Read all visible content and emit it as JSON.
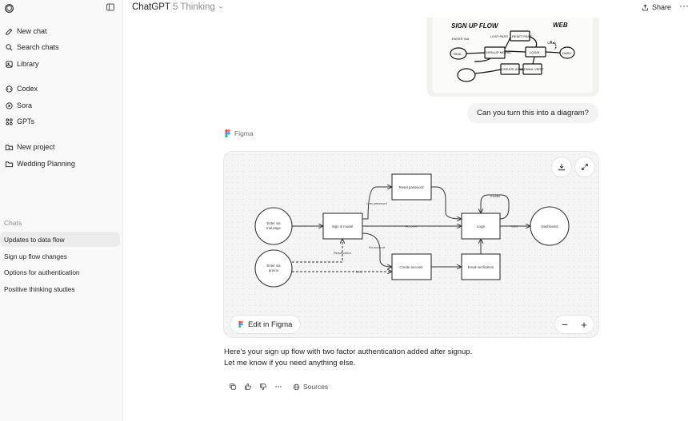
{
  "header": {
    "model_name": "ChatGPT",
    "model_version": "5 Thinking",
    "share_label": "Share",
    "more_label": "···"
  },
  "sidebar": {
    "nav": [
      {
        "label": "New chat",
        "icon": "new-chat-icon"
      },
      {
        "label": "Search chats",
        "icon": "search-icon"
      },
      {
        "label": "Library",
        "icon": "library-icon"
      },
      {
        "label": "Codex",
        "icon": "codex-icon"
      },
      {
        "label": "Sora",
        "icon": "sora-icon"
      },
      {
        "label": "GPTs",
        "icon": "gpts-icon"
      },
      {
        "label": "New project",
        "icon": "new-project-icon"
      },
      {
        "label": "Wedding Planning",
        "icon": "folder-icon"
      }
    ],
    "chats_label": "Chats",
    "chats": [
      {
        "label": "Updates to data flow",
        "active": true
      },
      {
        "label": "Sign up flow changes",
        "active": false
      },
      {
        "label": "Options for authentication",
        "active": false
      },
      {
        "label": "Positive thinking studies",
        "active": false
      }
    ]
  },
  "conversation": {
    "sketch": {
      "title": "SIGN UP FLOW",
      "corner": "WEB",
      "nodes": [
        "TRIAL",
        "SIGN-UP MODAL",
        "RESET PASS",
        "LOGIN",
        "DASH",
        "CREATE ACCT",
        "EMAIL VERIF",
        "ENTER VIA",
        "LOST PASS",
        "VALID"
      ]
    },
    "user_message": "Can you turn this into a diagram?",
    "tool_label": "Figma",
    "diagram": {
      "nodes": {
        "trial": "Enter via trial page",
        "promo": "Enter via promo",
        "modal": "Sign in modal",
        "reset": "Reset password",
        "login": "Login",
        "create": "Create account",
        "email": "Email verification",
        "dashboard": "Dashboard"
      },
      "edges": {
        "lost_password": "Lost password",
        "account": "Account",
        "no_account": "No account",
        "reactivation": "Reactivation",
        "new": "New",
        "valid": "Valid",
        "invalid": "Invalid"
      }
    },
    "edit_in_figma_label": "Edit in Figma",
    "zoom_out_label": "−",
    "zoom_in_label": "+",
    "reply_line1": "Here's your sign up flow with two factor authentication added after signup.",
    "reply_line2": "Let me know if you need anything else.",
    "sources_label": "Sources"
  }
}
